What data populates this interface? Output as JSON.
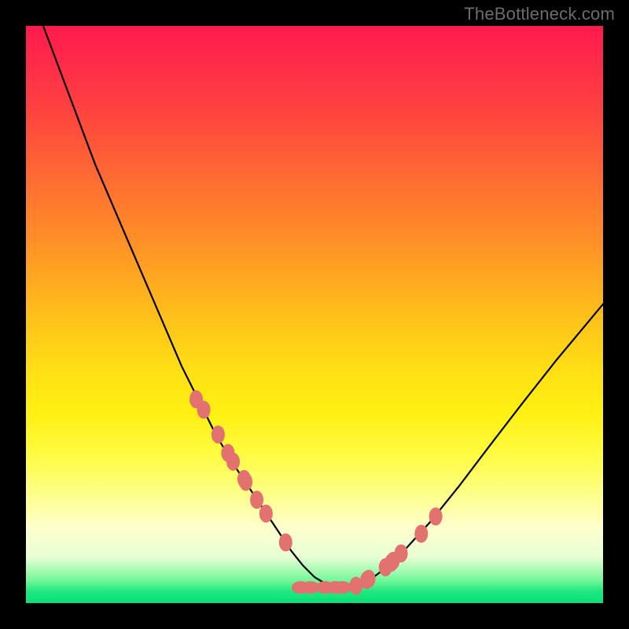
{
  "watermark": "TheBottleneck.com",
  "colors": {
    "frame": "#000000",
    "curve": "#000000",
    "marker_fill": "#e2716f",
    "marker_stroke": "#d96060",
    "gradient_top": "#ff1a4d",
    "gradient_bottom": "#0ae07a"
  },
  "chart_data": {
    "type": "line",
    "title": "",
    "xlabel": "",
    "ylabel": "",
    "xlim": [
      0,
      100
    ],
    "ylim": [
      0,
      100
    ],
    "curve": {
      "x": [
        3,
        6,
        9,
        12,
        15,
        18,
        21,
        24,
        27,
        30,
        33,
        36,
        38,
        40,
        42,
        44,
        46,
        48,
        50,
        52,
        54,
        56,
        59,
        62,
        66,
        70,
        75,
        80,
        86,
        92,
        100
      ],
      "y": [
        100,
        92,
        84,
        76,
        69,
        62,
        55,
        48,
        41,
        35,
        29,
        24,
        21,
        18,
        15,
        12,
        9,
        6.5,
        4.5,
        3.3,
        2.7,
        2.7,
        3.6,
        5.8,
        9.6,
        14.0,
        20.2,
        26.8,
        34.6,
        42.2,
        51.8
      ]
    },
    "markers_left": {
      "x": [
        29.5,
        30.8,
        33.3,
        35.0,
        35.9,
        37.8,
        38.1,
        40.0,
        41.6,
        45.0
      ],
      "y": [
        35.3,
        33.5,
        29.2,
        26.0,
        24.5,
        21.5,
        21.0,
        17.9,
        15.5,
        10.5
      ]
    },
    "markers_right": {
      "x": [
        57.2,
        59.1,
        59.4,
        62.3,
        63.3,
        63.6,
        65.0,
        68.5,
        71.0
      ],
      "y": [
        3.0,
        4.0,
        4.2,
        6.2,
        7.0,
        7.3,
        8.6,
        12.0,
        15.0
      ]
    },
    "markers_bottom": {
      "x": [
        47.6,
        49.3,
        51.8,
        53.6,
        54.8
      ],
      "y": [
        2.7,
        2.7,
        2.7,
        2.7,
        2.7
      ]
    }
  }
}
